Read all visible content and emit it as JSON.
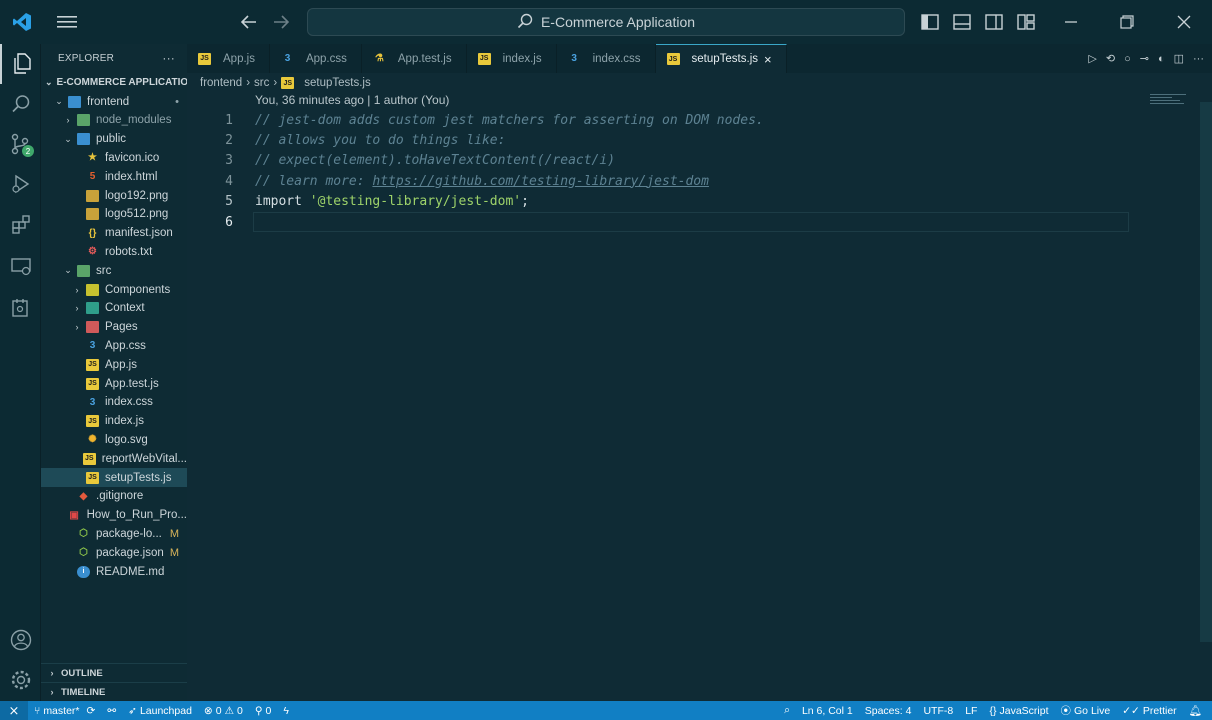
{
  "window": {
    "title": "E-Commerce Application"
  },
  "explorer": {
    "header": "EXPLORER",
    "more": "···",
    "root": "E-COMMERCE APPLICATION",
    "items": [
      {
        "label": "frontend",
        "depth": 1,
        "chev": "⌄",
        "icon": "folder-blue-icon",
        "mod": "•"
      },
      {
        "label": "node_modules",
        "depth": 2,
        "chev": "›",
        "icon": "folder-green-icon"
      },
      {
        "label": "public",
        "depth": 2,
        "chev": "⌄",
        "icon": "folder-blue-icon"
      },
      {
        "label": "favicon.ico",
        "depth": 3,
        "icon": "star-icon"
      },
      {
        "label": "index.html",
        "depth": 3,
        "icon": "html-icon"
      },
      {
        "label": "logo192.png",
        "depth": 3,
        "icon": "image-icon"
      },
      {
        "label": "logo512.png",
        "depth": 3,
        "icon": "image-icon"
      },
      {
        "label": "manifest.json",
        "depth": 3,
        "icon": "json-icon"
      },
      {
        "label": "robots.txt",
        "depth": 3,
        "icon": "robot-icon"
      },
      {
        "label": "src",
        "depth": 2,
        "chev": "⌄",
        "icon": "folder-green-icon"
      },
      {
        "label": "Components",
        "depth": 3,
        "chev": "›",
        "icon": "folder-yellow-icon"
      },
      {
        "label": "Context",
        "depth": 3,
        "chev": "›",
        "icon": "folder-teal-icon"
      },
      {
        "label": "Pages",
        "depth": 3,
        "chev": "›",
        "icon": "folder-red-icon"
      },
      {
        "label": "App.css",
        "depth": 3,
        "icon": "css-icon"
      },
      {
        "label": "App.js",
        "depth": 3,
        "icon": "js-icon"
      },
      {
        "label": "App.test.js",
        "depth": 3,
        "icon": "js-icon"
      },
      {
        "label": "index.css",
        "depth": 3,
        "icon": "css-icon"
      },
      {
        "label": "index.js",
        "depth": 3,
        "icon": "js-icon"
      },
      {
        "label": "logo.svg",
        "depth": 3,
        "icon": "svg-icon"
      },
      {
        "label": "reportWebVital...",
        "depth": 3,
        "icon": "js-icon"
      },
      {
        "label": "setupTests.js",
        "depth": 3,
        "icon": "js-icon",
        "selected": true
      },
      {
        "label": ".gitignore",
        "depth": 2,
        "icon": "git-icon"
      },
      {
        "label": "How_to_Run_Pro...",
        "depth": 2,
        "icon": "pdf-icon"
      },
      {
        "label": "package-lo...",
        "depth": 2,
        "icon": "npm-icon",
        "mod": "M"
      },
      {
        "label": "package.json",
        "depth": 2,
        "icon": "npm-icon",
        "mod": "M"
      },
      {
        "label": "README.md",
        "depth": 2,
        "icon": "info-icon"
      }
    ],
    "outline": "OUTLINE",
    "timeline": "TIMELINE"
  },
  "tabs": [
    {
      "label": "App.js",
      "icon": "js-icon"
    },
    {
      "label": "App.css",
      "icon": "css-icon"
    },
    {
      "label": "App.test.js",
      "icon": "flask-icon"
    },
    {
      "label": "index.js",
      "icon": "js-icon"
    },
    {
      "label": "index.css",
      "icon": "css-icon"
    },
    {
      "label": "setupTests.js",
      "icon": "js-icon",
      "active": true,
      "close": "×"
    }
  ],
  "breadcrumb": {
    "parts": [
      "frontend",
      "src",
      "setupTests.js"
    ],
    "sep": "›"
  },
  "blame": "You, 36 minutes ago | 1 author (You)",
  "code": {
    "l1": "// jest-dom adds custom jest matchers for asserting on DOM nodes.",
    "l2": "// allows you to do things like:",
    "l3": "// expect(element).toHaveTextContent(/react/i)",
    "l4a": "// learn more: ",
    "l4b": "https://github.com/testing-library/jest-dom",
    "l5a": "import ",
    "l5b": "'@testing-library/jest-dom'",
    "l5c": ";",
    "numbers": [
      "1",
      "2",
      "3",
      "4",
      "5",
      "6"
    ]
  },
  "status": {
    "branch": "master*",
    "launchpad": "Launchpad",
    "errors": "0",
    "warnings": "0",
    "ports": "0",
    "position": "Ln 6, Col 1",
    "spaces": "Spaces: 4",
    "encoding": "UTF-8",
    "eol": "LF",
    "language": "JavaScript",
    "golive": "Go Live",
    "prettier": "Prettier"
  },
  "badges": {
    "scm": "2"
  },
  "colors": {
    "accent": "#117fc4",
    "background": "#0f2b35",
    "comment": "#5d8292",
    "string": "#9ed36a"
  }
}
